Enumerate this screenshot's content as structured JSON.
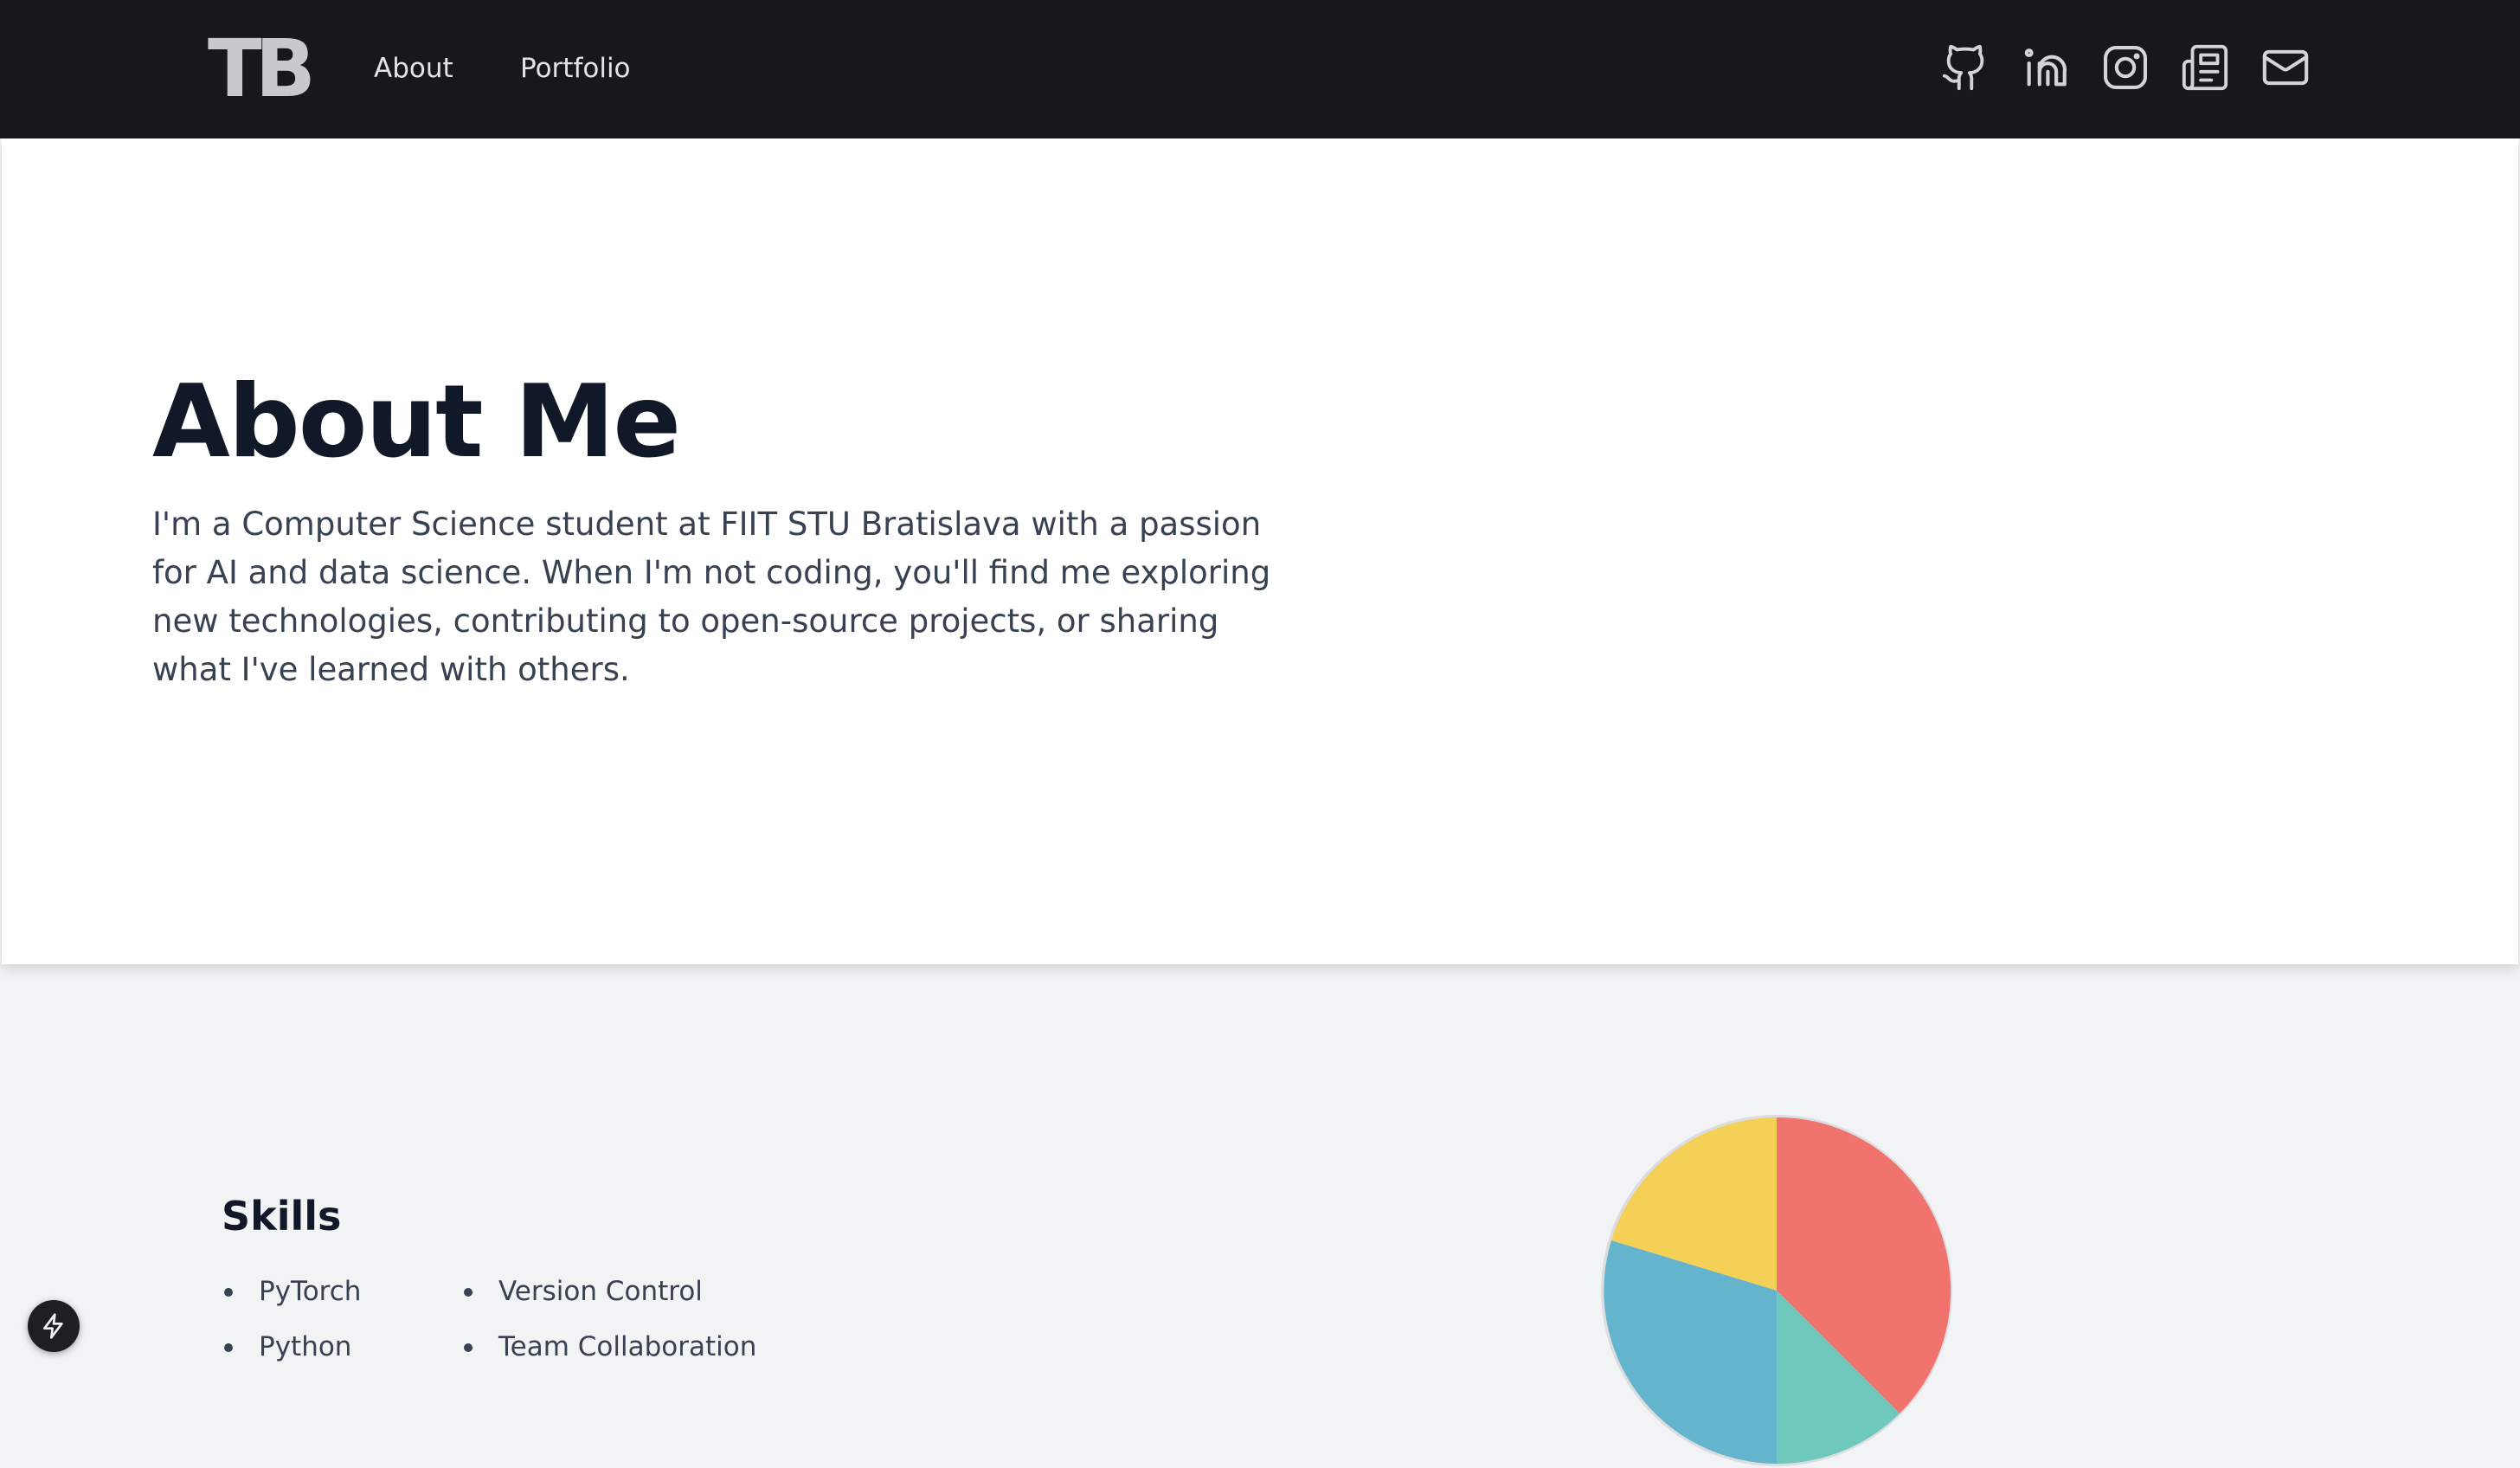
{
  "navbar": {
    "logo": "TB",
    "links": [
      "About",
      "Portfolio"
    ],
    "social_icons": [
      "github-icon",
      "linkedin-icon",
      "instagram-icon",
      "newspaper-icon",
      "mail-icon"
    ]
  },
  "hero": {
    "title": "About Me",
    "description": "I'm a Computer Science student at FIIT STU Bratislava with a passion for AI and data science. When I'm not coding, you'll find me exploring new technologies, contributing to open-source projects, or sharing what I've learned with others."
  },
  "skills": {
    "title": "Skills",
    "items": [
      "PyTorch",
      "Python",
      "Version Control",
      "Team Collaboration"
    ]
  },
  "colors": {
    "navbar_bg": "#18181b",
    "page_bg": "#f2f3f5",
    "pie_red": "#f0736e",
    "pie_yellow": "#f5d056",
    "pie_blue": "#65b4cd",
    "pie_teal": "#6ec9bc"
  }
}
